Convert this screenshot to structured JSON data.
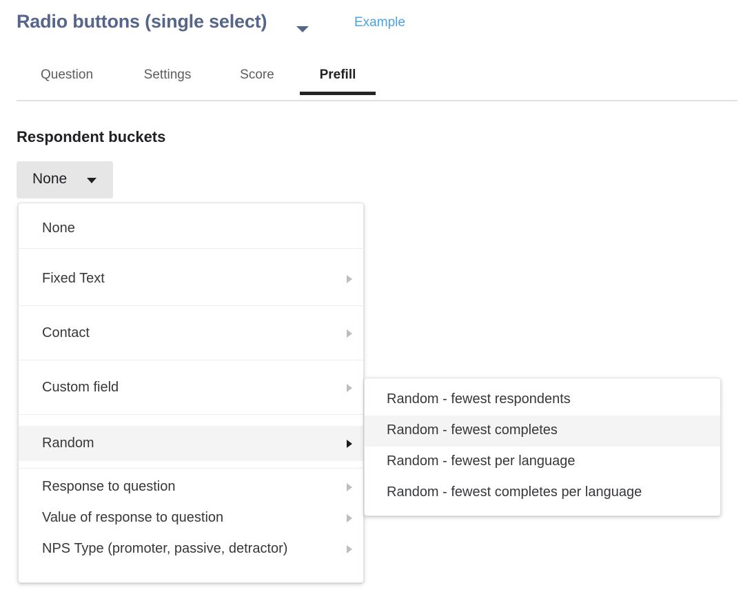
{
  "header": {
    "title": "Radio buttons (single select)",
    "title_caret_icon": "caret-down-icon",
    "example_link": "Example"
  },
  "tabs": [
    {
      "label": "Question",
      "active": false
    },
    {
      "label": "Settings",
      "active": false
    },
    {
      "label": "Score",
      "active": false
    },
    {
      "label": "Prefill",
      "active": true
    }
  ],
  "section": {
    "title": "Respondent buckets"
  },
  "select_button": {
    "value": "None",
    "caret_icon": "caret-down-icon"
  },
  "main_menu": {
    "items": [
      {
        "label": "None",
        "has_submenu": false,
        "hover": false
      },
      {
        "label": "Fixed Text",
        "has_submenu": true,
        "hover": false
      },
      {
        "label": "Contact",
        "has_submenu": true,
        "hover": false
      },
      {
        "label": "Custom field",
        "has_submenu": true,
        "hover": false
      },
      {
        "label": "Random",
        "has_submenu": true,
        "hover": true
      },
      {
        "label": "Response to question",
        "has_submenu": true,
        "hover": false
      },
      {
        "label": "Value of response to question",
        "has_submenu": true,
        "hover": false
      },
      {
        "label": "NPS Type (promoter, passive, detractor)",
        "has_submenu": true,
        "hover": false
      }
    ]
  },
  "sub_menu": {
    "items": [
      {
        "label": "Random - fewest respondents",
        "hover": false
      },
      {
        "label": "Random - fewest completes",
        "hover": true
      },
      {
        "label": "Random - fewest per language",
        "hover": false
      },
      {
        "label": "Random - fewest completes per language",
        "hover": false
      }
    ]
  },
  "colors": {
    "title": "#56658a",
    "link": "#4aa3e0",
    "tab_active": "#202124",
    "tab_inactive": "#5c5c5c",
    "menu_hover": "#f4f4f4",
    "select_bg": "#e6e6e6"
  }
}
